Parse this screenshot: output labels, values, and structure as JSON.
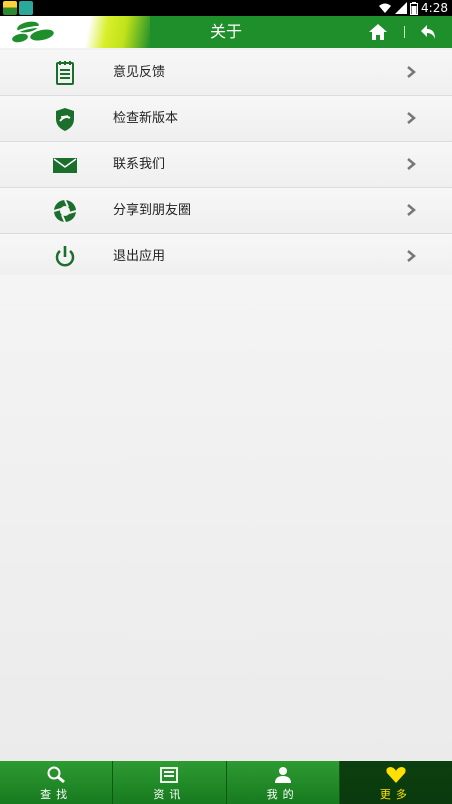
{
  "status_bar": {
    "time": "4:28"
  },
  "header": {
    "title": "关于",
    "icons": [
      "logo-icon",
      "home-icon",
      "back-icon"
    ]
  },
  "menu": {
    "items": [
      {
        "label": "意见反馈",
        "icon": "feedback-notepad-icon"
      },
      {
        "label": "检查新版本",
        "icon": "shield-update-icon"
      },
      {
        "label": "联系我们",
        "icon": "envelope-icon"
      },
      {
        "label": "分享到朋友圈",
        "icon": "camera-shutter-icon"
      },
      {
        "label": "退出应用",
        "icon": "power-icon"
      }
    ]
  },
  "tabs": [
    {
      "label": "查找",
      "icon": "search-icon",
      "active": false
    },
    {
      "label": "资讯",
      "icon": "news-icon",
      "active": false
    },
    {
      "label": "我的",
      "icon": "user-icon",
      "active": false
    },
    {
      "label": "更多",
      "icon": "heart-icon",
      "active": true
    }
  ],
  "colors": {
    "brand_green": "#1f8f2b",
    "icon_green": "#1b6e2c",
    "active_tab_text": "#ffe000"
  }
}
